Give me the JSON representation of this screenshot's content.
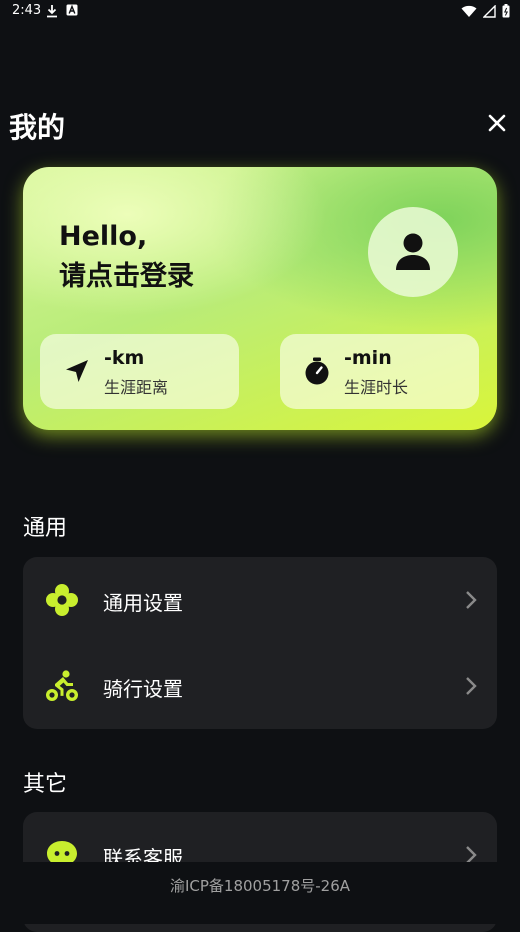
{
  "status_bar": {
    "time": "2:43"
  },
  "header": {
    "title": "我的"
  },
  "profile": {
    "greeting_line1": "Hello,",
    "greeting_line2": "请点击登录",
    "stats": [
      {
        "value": "-km",
        "label": "生涯距离",
        "icon": "navigation-arrow-icon"
      },
      {
        "value": "-min",
        "label": "生涯时长",
        "icon": "stopwatch-icon"
      }
    ]
  },
  "sections": [
    {
      "title": "通用",
      "items": [
        {
          "label": "通用设置",
          "icon": "flower-settings-icon"
        },
        {
          "label": "骑行设置",
          "icon": "cyclist-icon"
        }
      ]
    },
    {
      "title": "其它",
      "items": [
        {
          "label": "联系客服",
          "icon": "chat-bubble-icon"
        }
      ]
    }
  ],
  "footer": {
    "icp": "渝ICP备18005178号-26A"
  },
  "colors": {
    "accent": "#c8ee2e",
    "background": "#0e1013",
    "card": "#1f2023"
  }
}
